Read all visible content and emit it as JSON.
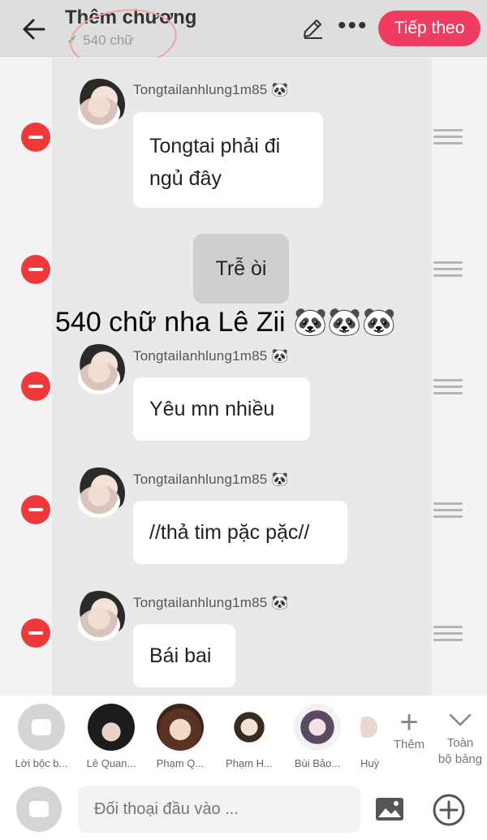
{
  "header": {
    "title": "Thêm chương",
    "word_count": "540 chữ",
    "next_label": "Tiếp theo"
  },
  "overlay_text": "540 chữ nha Lê Zii 🐼🐼🐼",
  "messages": [
    {
      "name": "Tongtailanhlung1m85 🐼",
      "text": "Tongtai phải đi\nngủ đây"
    },
    {
      "narration": "Trễ òi"
    },
    {
      "name": "Tongtailanhlung1m85 🐼",
      "text": "Yêu mn nhiều"
    },
    {
      "name": "Tongtailanhlung1m85 🐼",
      "text": "//thả tim pặc pặc//"
    },
    {
      "name": "Tongtailanhlung1m85 🐼",
      "text": "Bái bai"
    }
  ],
  "characters": [
    {
      "label": "Lời bộc b..."
    },
    {
      "label": "Lê Quan..."
    },
    {
      "label": "Phạm Q..."
    },
    {
      "label": "Phạm H..."
    },
    {
      "label": "Bùi Bảo..."
    },
    {
      "label": "Huỳ"
    }
  ],
  "more_label": "Thêm",
  "all_table_label": "Toàn\nbộ bảng",
  "input": {
    "placeholder": "Đối thoại đầu vào ..."
  },
  "colors": {
    "accent": "#f03c62",
    "remove": "#f03a3a",
    "check": "#34b96b"
  },
  "icons": [
    "back-arrow-icon",
    "check-icon",
    "pencil-icon",
    "more-icon",
    "remove-icon",
    "drag-handle-icon",
    "plus-icon",
    "chevron-down-icon",
    "chat-bubble-icon",
    "image-icon",
    "add-circle-icon"
  ]
}
